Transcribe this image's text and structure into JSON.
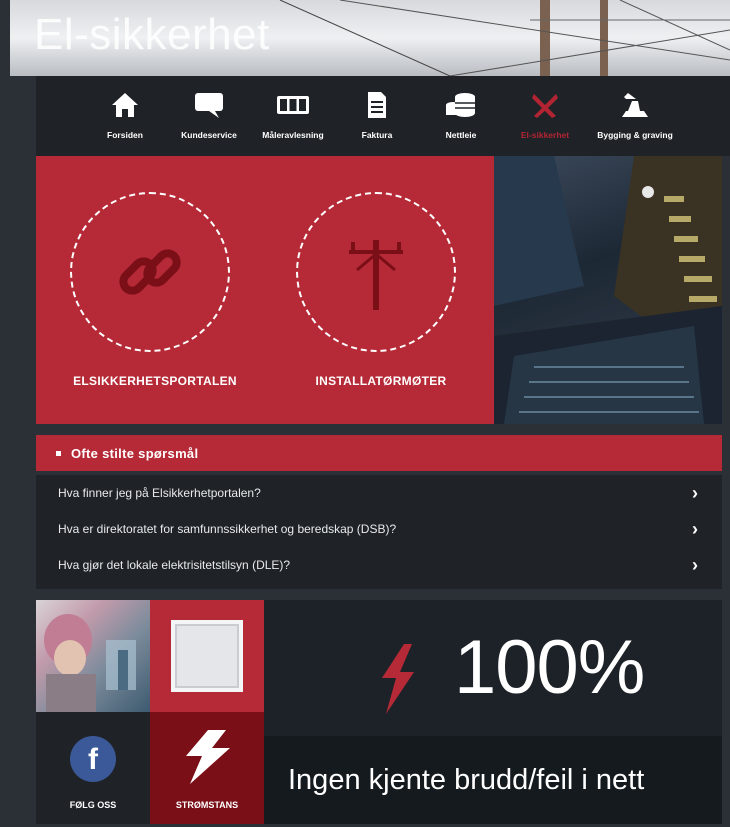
{
  "hero": {
    "title": "El-sikkerhet"
  },
  "nav": {
    "items": [
      {
        "label": "Forsiden",
        "icon": "home-icon"
      },
      {
        "label": "Kundeservice",
        "icon": "speech-bubble-icon"
      },
      {
        "label": "Måleravlesning",
        "icon": "meter-icon"
      },
      {
        "label": "Faktura",
        "icon": "document-icon"
      },
      {
        "label": "Nettleie",
        "icon": "coins-icon"
      },
      {
        "label": "El-sikkerhet",
        "icon": "tools-icon",
        "active": true
      },
      {
        "label": "Bygging & graving",
        "icon": "excavator-icon"
      }
    ]
  },
  "links": [
    {
      "label": "ELSIKKERHETSPORTALEN",
      "icon": "chain-link-icon"
    },
    {
      "label": "INSTALLATØRMØTER",
      "icon": "power-pole-icon"
    }
  ],
  "faq": {
    "title": "Ofte stilte spørsmål",
    "items": [
      "Hva finner jeg på Elsikkerhetportalen?",
      "Hva er direktoratet for samfunnssikkerhet og beredskap (DSB)?",
      "Hva gjør det lokale elektrisitetstilsyn (DLE)?"
    ]
  },
  "tiles": {
    "follow_label": "FØLG OSS",
    "outage_label": "STRØMSTANS",
    "status_percent": "100%",
    "status_message": "Ingen kjente brudd/feil i nett",
    "facebook_letter": "f"
  },
  "colors": {
    "accent": "#b62a37",
    "dark": "#1f2327",
    "deep_red": "#7a0f18"
  }
}
